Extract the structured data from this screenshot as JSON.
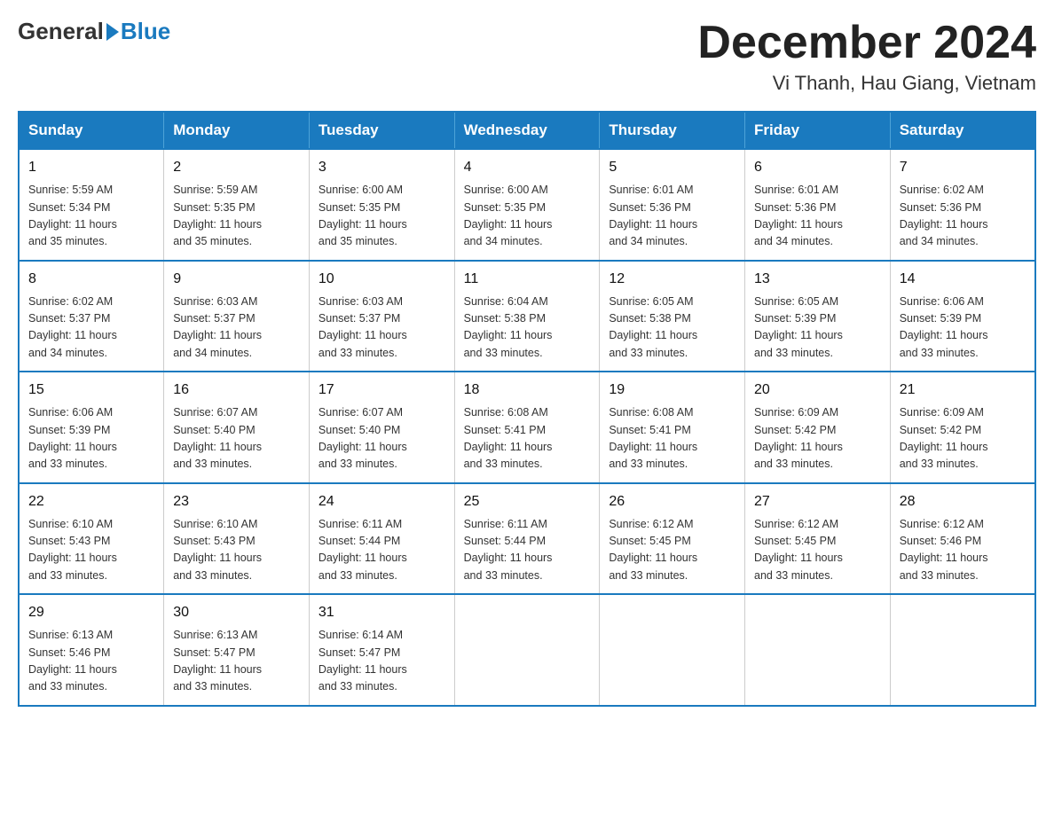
{
  "logo": {
    "text_general": "General",
    "text_blue": "Blue"
  },
  "title": "December 2024",
  "subtitle": "Vi Thanh, Hau Giang, Vietnam",
  "calendar": {
    "headers": [
      "Sunday",
      "Monday",
      "Tuesday",
      "Wednesday",
      "Thursday",
      "Friday",
      "Saturday"
    ],
    "weeks": [
      [
        {
          "day": "1",
          "sunrise": "5:59 AM",
          "sunset": "5:34 PM",
          "daylight": "11 hours and 35 minutes."
        },
        {
          "day": "2",
          "sunrise": "5:59 AM",
          "sunset": "5:35 PM",
          "daylight": "11 hours and 35 minutes."
        },
        {
          "day": "3",
          "sunrise": "6:00 AM",
          "sunset": "5:35 PM",
          "daylight": "11 hours and 35 minutes."
        },
        {
          "day": "4",
          "sunrise": "6:00 AM",
          "sunset": "5:35 PM",
          "daylight": "11 hours and 34 minutes."
        },
        {
          "day": "5",
          "sunrise": "6:01 AM",
          "sunset": "5:36 PM",
          "daylight": "11 hours and 34 minutes."
        },
        {
          "day": "6",
          "sunrise": "6:01 AM",
          "sunset": "5:36 PM",
          "daylight": "11 hours and 34 minutes."
        },
        {
          "day": "7",
          "sunrise": "6:02 AM",
          "sunset": "5:36 PM",
          "daylight": "11 hours and 34 minutes."
        }
      ],
      [
        {
          "day": "8",
          "sunrise": "6:02 AM",
          "sunset": "5:37 PM",
          "daylight": "11 hours and 34 minutes."
        },
        {
          "day": "9",
          "sunrise": "6:03 AM",
          "sunset": "5:37 PM",
          "daylight": "11 hours and 34 minutes."
        },
        {
          "day": "10",
          "sunrise": "6:03 AM",
          "sunset": "5:37 PM",
          "daylight": "11 hours and 33 minutes."
        },
        {
          "day": "11",
          "sunrise": "6:04 AM",
          "sunset": "5:38 PM",
          "daylight": "11 hours and 33 minutes."
        },
        {
          "day": "12",
          "sunrise": "6:05 AM",
          "sunset": "5:38 PM",
          "daylight": "11 hours and 33 minutes."
        },
        {
          "day": "13",
          "sunrise": "6:05 AM",
          "sunset": "5:39 PM",
          "daylight": "11 hours and 33 minutes."
        },
        {
          "day": "14",
          "sunrise": "6:06 AM",
          "sunset": "5:39 PM",
          "daylight": "11 hours and 33 minutes."
        }
      ],
      [
        {
          "day": "15",
          "sunrise": "6:06 AM",
          "sunset": "5:39 PM",
          "daylight": "11 hours and 33 minutes."
        },
        {
          "day": "16",
          "sunrise": "6:07 AM",
          "sunset": "5:40 PM",
          "daylight": "11 hours and 33 minutes."
        },
        {
          "day": "17",
          "sunrise": "6:07 AM",
          "sunset": "5:40 PM",
          "daylight": "11 hours and 33 minutes."
        },
        {
          "day": "18",
          "sunrise": "6:08 AM",
          "sunset": "5:41 PM",
          "daylight": "11 hours and 33 minutes."
        },
        {
          "day": "19",
          "sunrise": "6:08 AM",
          "sunset": "5:41 PM",
          "daylight": "11 hours and 33 minutes."
        },
        {
          "day": "20",
          "sunrise": "6:09 AM",
          "sunset": "5:42 PM",
          "daylight": "11 hours and 33 minutes."
        },
        {
          "day": "21",
          "sunrise": "6:09 AM",
          "sunset": "5:42 PM",
          "daylight": "11 hours and 33 minutes."
        }
      ],
      [
        {
          "day": "22",
          "sunrise": "6:10 AM",
          "sunset": "5:43 PM",
          "daylight": "11 hours and 33 minutes."
        },
        {
          "day": "23",
          "sunrise": "6:10 AM",
          "sunset": "5:43 PM",
          "daylight": "11 hours and 33 minutes."
        },
        {
          "day": "24",
          "sunrise": "6:11 AM",
          "sunset": "5:44 PM",
          "daylight": "11 hours and 33 minutes."
        },
        {
          "day": "25",
          "sunrise": "6:11 AM",
          "sunset": "5:44 PM",
          "daylight": "11 hours and 33 minutes."
        },
        {
          "day": "26",
          "sunrise": "6:12 AM",
          "sunset": "5:45 PM",
          "daylight": "11 hours and 33 minutes."
        },
        {
          "day": "27",
          "sunrise": "6:12 AM",
          "sunset": "5:45 PM",
          "daylight": "11 hours and 33 minutes."
        },
        {
          "day": "28",
          "sunrise": "6:12 AM",
          "sunset": "5:46 PM",
          "daylight": "11 hours and 33 minutes."
        }
      ],
      [
        {
          "day": "29",
          "sunrise": "6:13 AM",
          "sunset": "5:46 PM",
          "daylight": "11 hours and 33 minutes."
        },
        {
          "day": "30",
          "sunrise": "6:13 AM",
          "sunset": "5:47 PM",
          "daylight": "11 hours and 33 minutes."
        },
        {
          "day": "31",
          "sunrise": "6:14 AM",
          "sunset": "5:47 PM",
          "daylight": "11 hours and 33 minutes."
        },
        null,
        null,
        null,
        null
      ]
    ],
    "labels": {
      "sunrise": "Sunrise:",
      "sunset": "Sunset:",
      "daylight": "Daylight:"
    }
  }
}
